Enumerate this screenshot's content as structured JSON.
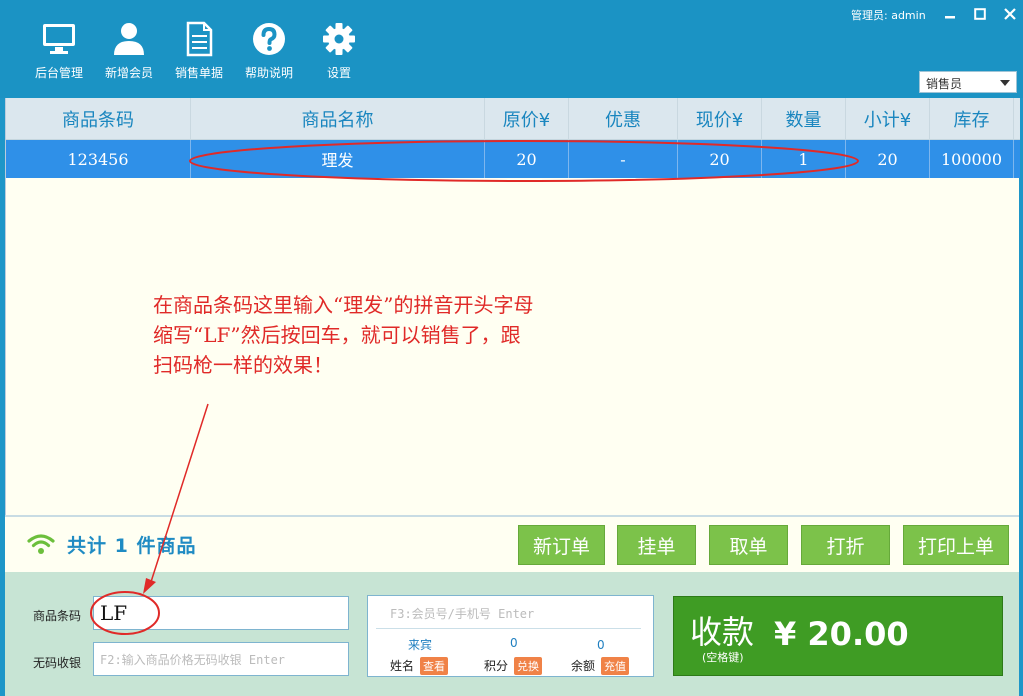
{
  "header": {
    "toolbar": [
      {
        "label": "后台管理",
        "icon": "monitor-icon"
      },
      {
        "label": "新增会员",
        "icon": "user-icon"
      },
      {
        "label": "销售单据",
        "icon": "document-icon"
      },
      {
        "label": "帮助说明",
        "icon": "help-icon"
      },
      {
        "label": "设置",
        "icon": "gear-icon"
      }
    ],
    "admin_label": "管理员: admin",
    "role_select": "销售员"
  },
  "table": {
    "columns": [
      "商品条码",
      "商品名称",
      "原价¥",
      "优惠",
      "现价¥",
      "数量",
      "小计¥",
      "库存"
    ],
    "rows": [
      {
        "barcode": "123456",
        "name": "理发",
        "orig_price": "20",
        "discount": "-",
        "price": "20",
        "qty": "1",
        "subtotal": "20",
        "stock": "100000"
      }
    ]
  },
  "annotation": {
    "lines": [
      "在商品条码这里输入“理发”的拼音开头字母",
      "缩写“LF”然后按回车，就可以销售了，跟",
      "扫码枪一样的效果！"
    ]
  },
  "summary": {
    "total_text": "共计 1 件商品",
    "buttons": [
      "新订单",
      "挂单",
      "取单",
      "打折",
      "打印上单"
    ]
  },
  "bottom": {
    "barcode_label": "商品条码",
    "barcode_value": "LF",
    "nocode_label": "无码收银",
    "nocode_placeholder": "F2:输入商品价格无码收银 Enter",
    "member_placeholder": "F3:会员号/手机号 Enter",
    "member": {
      "name_value": "来宾",
      "points_value": "0",
      "balance_value": "0",
      "name_label": "姓名",
      "view_btn": "查看",
      "points_label": "积分",
      "redeem_btn": "兑换",
      "balance_label": "余额",
      "recharge_btn": "充值"
    },
    "checkout": {
      "title": "收款",
      "hint": "(空格键)",
      "amount": "¥ 20.00"
    }
  },
  "colors": {
    "header_bg": "#1b93c4",
    "selected_row": "#2f90e8",
    "action_button": "#7cc24a",
    "checkout_button": "#3f9c24",
    "annotation_red": "#e02a28"
  }
}
